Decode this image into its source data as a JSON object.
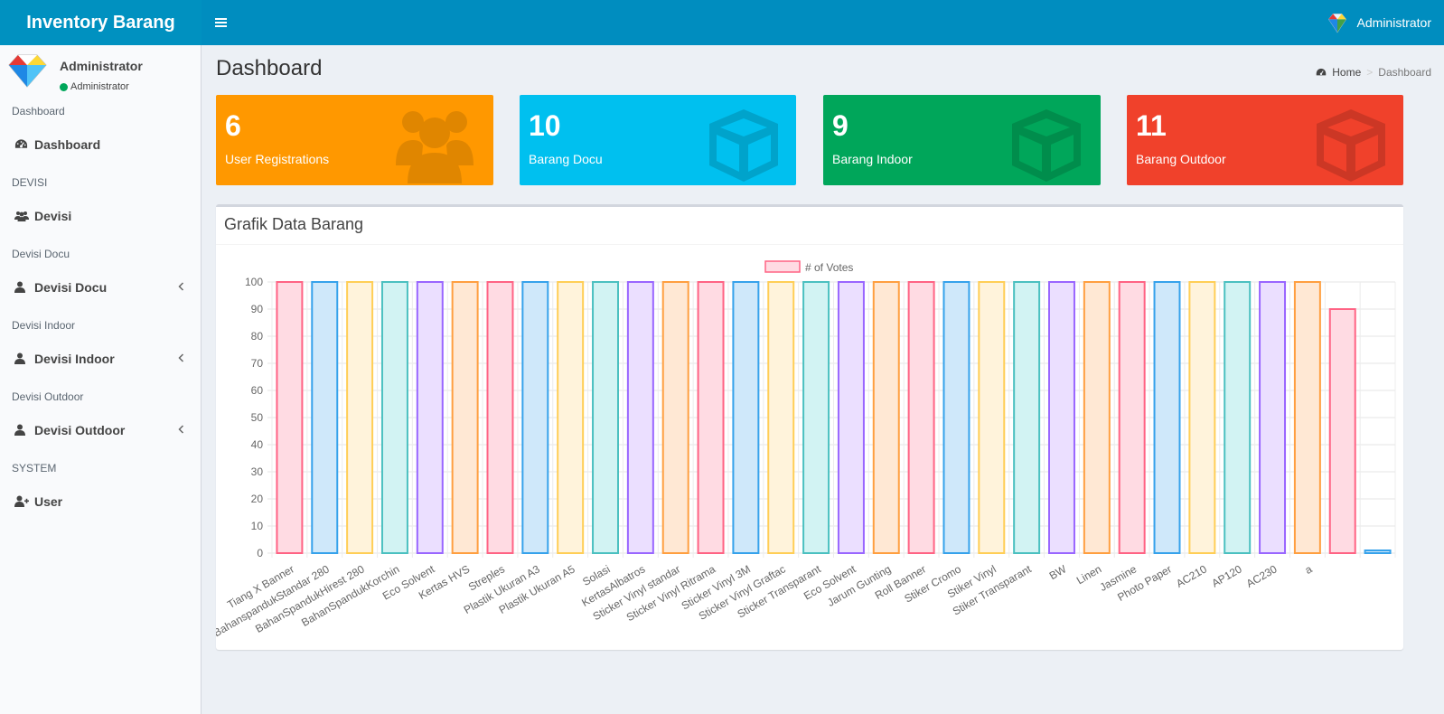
{
  "header": {
    "brand": "Inventory Barang",
    "user_name": "Administrator"
  },
  "sidebar": {
    "user": {
      "name": "Administrator",
      "status": "Administrator"
    },
    "sections": [
      {
        "header": "Dashboard",
        "item": {
          "label": "Dashboard",
          "icon": "dashboard-icon",
          "has_children": false
        }
      },
      {
        "header": "DEVISI",
        "item": {
          "label": "Devisi",
          "icon": "users-icon",
          "has_children": false
        }
      },
      {
        "header": "Devisi Docu",
        "item": {
          "label": "Devisi Docu",
          "icon": "user-icon",
          "has_children": true
        }
      },
      {
        "header": "Devisi Indoor",
        "item": {
          "label": "Devisi Indoor",
          "icon": "user-icon",
          "has_children": true
        }
      },
      {
        "header": "Devisi Outdoor",
        "item": {
          "label": "Devisi Outdoor",
          "icon": "user-icon",
          "has_children": true
        }
      },
      {
        "header": "SYSTEM",
        "item": {
          "label": "User",
          "icon": "user-plus-icon",
          "has_children": false
        }
      }
    ]
  },
  "page": {
    "title": "Dashboard",
    "breadcrumb": {
      "home": "Home",
      "current": "Dashboard"
    }
  },
  "stat_boxes": [
    {
      "value": "6",
      "label": "User Registrations",
      "color": "#ff9800",
      "icon_color": "#e08600",
      "icon": "users-icon"
    },
    {
      "value": "10",
      "label": "Barang Docu",
      "color": "#00c0ef",
      "icon_color": "#00a3cb",
      "icon": "cube-icon"
    },
    {
      "value": "9",
      "label": "Barang Indoor",
      "color": "#00a65a",
      "icon_color": "#008d4c",
      "icon": "cube-icon"
    },
    {
      "value": "11",
      "label": "Barang Outdoor",
      "color": "#f0412b",
      "icon_color": "#cc3725",
      "icon": "cube-icon"
    }
  ],
  "chart_box": {
    "title": "Grafik Data Barang"
  },
  "chart_data": {
    "type": "bar",
    "title": "",
    "xlabel": "",
    "ylabel": "",
    "ylim": [
      0,
      100
    ],
    "yticks": [
      0,
      10,
      20,
      30,
      40,
      50,
      60,
      70,
      80,
      90,
      100
    ],
    "grid": true,
    "legend_position": "top",
    "series": [
      {
        "name": "# of Votes",
        "values": [
          100,
          100,
          100,
          100,
          100,
          100,
          100,
          100,
          100,
          100,
          100,
          100,
          100,
          100,
          100,
          100,
          100,
          100,
          100,
          100,
          100,
          100,
          100,
          100,
          100,
          100,
          100,
          100,
          100,
          100,
          90,
          1
        ]
      }
    ],
    "categories": [
      "Tiang X Banner",
      "BahanspandukStandar 280",
      "BahanSpandukHirest 280",
      "BahanSpandukKorchin",
      "Eco Solvent",
      "Kertas HVS",
      "Streples",
      "Plastik Ukuran A3",
      "Plastik Ukuran A5",
      "Solasi",
      "KertasAlbatros",
      "Sticker Vinyl standar",
      "Sticker Vinyl Ritrama",
      "Sticker Vinyl 3M",
      "Sticker Vinyl Graftac",
      "Sticker Transparant",
      "Eco Solvent",
      "Jarum Gunting",
      "Roll Banner",
      "Stiker Cromo",
      "Stiker Vinyl",
      "Stiker Transparant",
      "BW",
      "Linen",
      "Jasmine",
      "Photo Paper",
      "AC210",
      "AP120",
      "AC230",
      "a"
    ],
    "bar_fill_colors": [
      "#ffdbe3",
      "#cfe8fa",
      "#fff3db",
      "#d2f3f3",
      "#ebdfff",
      "#ffe8d4"
    ],
    "bar_border_colors": [
      "#ff6384",
      "#36a2eb",
      "#ffce56",
      "#4bc0c0",
      "#9966ff",
      "#ff9f40"
    ]
  }
}
